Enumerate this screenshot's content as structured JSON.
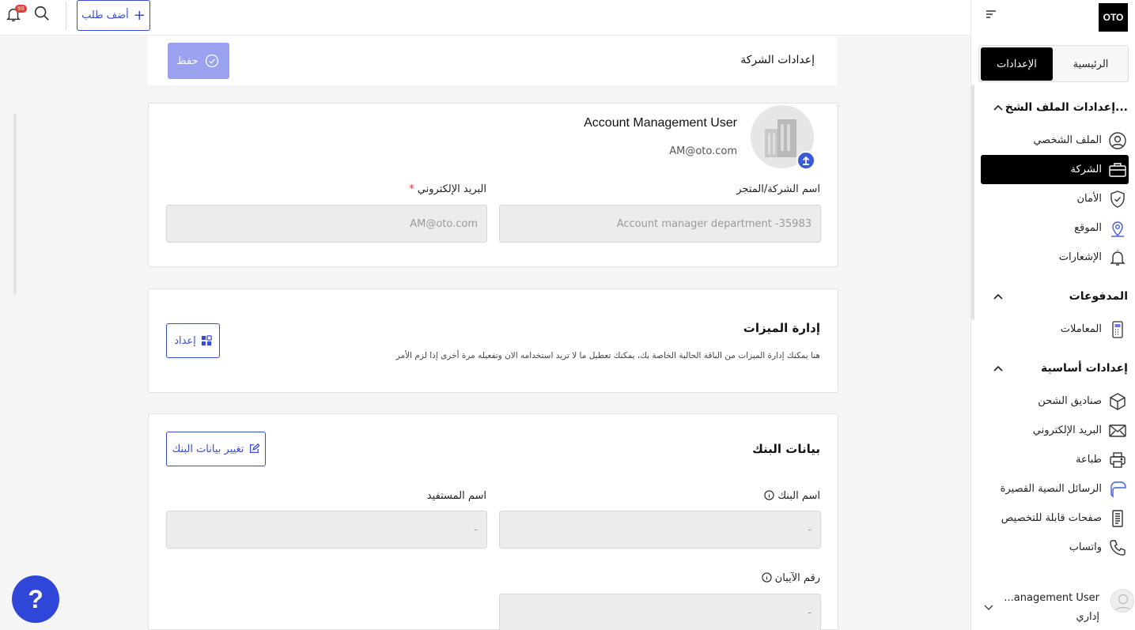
{
  "topbar": {
    "add_order_label": "أضف طلب",
    "notification_count": "98"
  },
  "sidebar": {
    "logo": "OTO",
    "tabs": {
      "settings": "الإعدادات",
      "home": "الرئيسية"
    },
    "sections": [
      {
        "title": "إعدادات الملف الشخ...",
        "items": [
          {
            "label": "الملف الشخصي",
            "icon": "user-circle-icon"
          },
          {
            "label": "الشركة",
            "icon": "briefcase-icon",
            "active": true
          },
          {
            "label": "الأمان",
            "icon": "shield-icon"
          },
          {
            "label": "الموقع",
            "icon": "location-pin-icon"
          },
          {
            "label": "الإشعارات",
            "icon": "bell-icon"
          }
        ]
      },
      {
        "title": "المدفوعات",
        "items": [
          {
            "label": "المعاملات",
            "icon": "transactions-icon"
          }
        ]
      },
      {
        "title": "إعدادات أساسية",
        "items": [
          {
            "label": "صناديق الشحن",
            "icon": "box-icon"
          },
          {
            "label": "البريد الإلكتروني",
            "icon": "mail-icon"
          },
          {
            "label": "طباعة",
            "icon": "printer-icon"
          },
          {
            "label": "الرسائل النصية القصيرة",
            "icon": "sms-icon"
          },
          {
            "label": "صفحات قابلة للتخصيص",
            "icon": "page-icon"
          },
          {
            "label": "واتساب",
            "icon": "phone-icon"
          }
        ]
      }
    ],
    "user": {
      "name": "...anagement User",
      "role": "إداري"
    }
  },
  "page": {
    "title": "إعدادات الشركة",
    "save_label": "حفظ"
  },
  "profile": {
    "name": "Account Management User",
    "email": "AM@oto.com",
    "company_label": "اسم الشركة/المتجر",
    "company_value": "Account manager department -35983",
    "email_label": "البريد الإلكتروني",
    "email_required": "*",
    "email_value": "AM@oto.com"
  },
  "features": {
    "title": "إدارة الميزات",
    "description": "هنا يمكنك إدارة الميزات من الباقة الحالية الخاصة بك، يمكنك تعطيل ما لا تريد استخدامه الان وتفعيله مرة أخرى إذا لزم الأمر",
    "setup_label": "إعداد"
  },
  "bank": {
    "title": "بيانات البنك",
    "change_label": "تغيير بيانات البنك",
    "bank_name_label": "اسم البنك",
    "bank_name_value": "-",
    "beneficiary_label": "اسم المستفيد",
    "beneficiary_value": "-",
    "iban_label": "رقم الآيبان",
    "iban_value": "-"
  },
  "help_label": "?"
}
